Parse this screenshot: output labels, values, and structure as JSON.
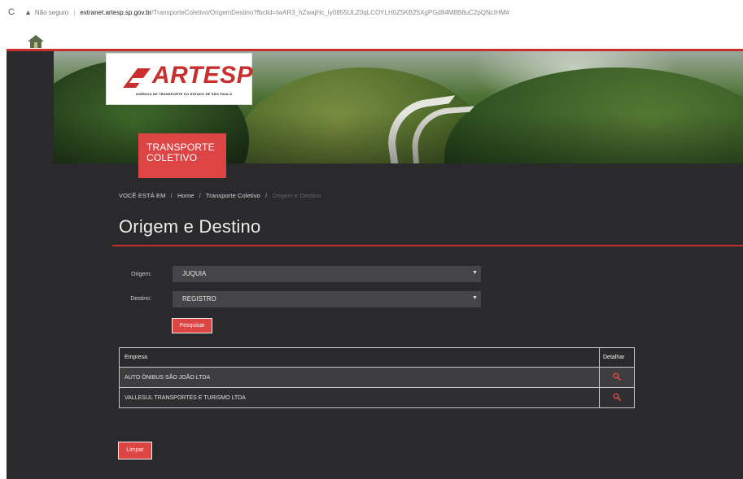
{
  "browser": {
    "reload_glyph": "C",
    "warning_glyph": "▲",
    "security_label": "Não seguro",
    "url_host": "extranet.artesp.sp.gov.br",
    "url_path": "/TransporteColetivo/OrigemDestino?fbclid=IwAR3_hZwajHc_Iy0855ULZ0qLCOYLH0Z5KB25XgPGd84M8B8uC2pQNcIHM#"
  },
  "header": {
    "logo_text": "ARTESP",
    "logo_subtitle": "AGÊNCIA DE TRANSPORTE DO ESTADO DE SÃO PAULO",
    "section_tag": "TRANSPORTE COLETIVO"
  },
  "breadcrumb": {
    "prefix": "VOCÊ ESTÁ EM",
    "separator": "/",
    "items": [
      "Home",
      "Transporte Coletivo",
      "Origem e Destino"
    ]
  },
  "page": {
    "title": "Origem e Destino"
  },
  "form": {
    "origin_label": "Origem:",
    "origin_value": "JUQUIA",
    "destination_label": "Destino:",
    "destination_value": "REGISTRO",
    "search_button": "Pesquisar"
  },
  "results": {
    "headers": [
      "Empresa",
      "Detalhar"
    ],
    "rows": [
      {
        "company": "AUTO ÔNIBUS SÃO JOÃO LTDA"
      },
      {
        "company": "VALLESUL TRANSPORTES E TURISMO LTDA"
      }
    ]
  },
  "clear_button": "Limpar",
  "colors": {
    "accent": "#dd4444",
    "rule": "#c8302f",
    "page_bg": "#2a2a2c"
  },
  "icons": {
    "detail": "search-icon",
    "select_caret": "chevron-down-icon"
  }
}
